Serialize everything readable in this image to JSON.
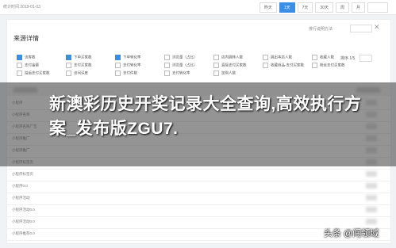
{
  "topbar": {
    "stat_text": "统计时间 2019-01-03",
    "periods": [
      {
        "label": "昨天"
      },
      {
        "label": "1天"
      },
      {
        "label": "7天"
      },
      {
        "label": "30天"
      },
      {
        "label": "周"
      },
      {
        "label": "月"
      }
    ]
  },
  "panel": {
    "title": "来源详情",
    "note": "排行说明方法",
    "filters": [
      [
        "访客数",
        "下单买家数",
        "下单转化率",
        "浏览量（占比）",
        "店内跳转人数",
        "跳出本店人数",
        "收藏人数",
        "加购人数"
      ],
      [
        "支付金额",
        "支付买家数",
        "支付转化率",
        "浏览量（占比）",
        "直接支付买家数",
        "收藏商品-支付买家数",
        "粉丝支付买家数",
        "加购商品-支付买家数"
      ],
      [
        "拍后支付买家数",
        "访问深度",
        "支付件数",
        "支付转化率",
        "加购人数"
      ]
    ],
    "sort_label": "排序 1/5",
    "rows": [
      "小程序",
      "小程序名称",
      "小程序名称广告",
      "小程序推广",
      "小程序推广",
      "小程序标签页",
      "小程序标签页",
      "小程序0.0",
      "小程序活动",
      "小程序活动0.0",
      "小程序活动0.0",
      "小程序推荐0.0"
    ]
  },
  "headline": "新澳彩历史开奖记录大全查询,高效执行方案_发布版ZGU7.",
  "watermark": "头条 @闯领域"
}
